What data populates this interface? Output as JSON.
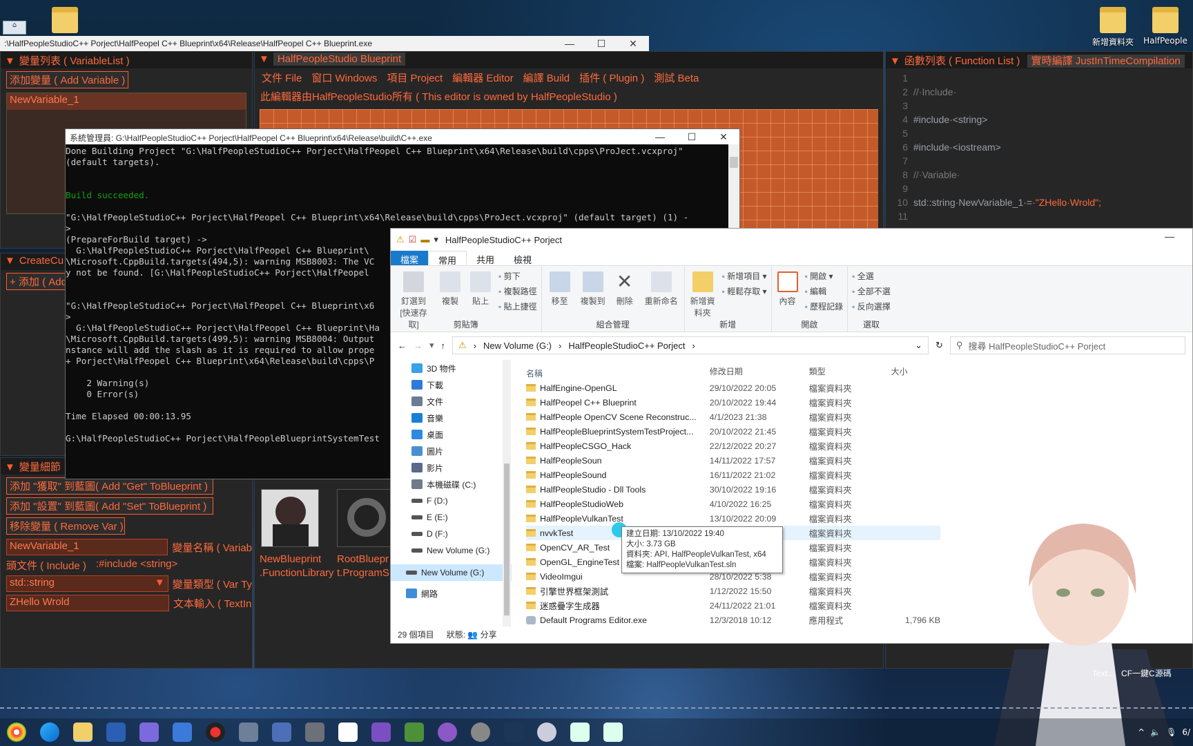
{
  "desktop": {
    "icons": [
      {
        "label": "新增資料夾"
      },
      {
        "label": "HalfPeople"
      }
    ]
  },
  "blueprint": {
    "window_title": ":\\HalfPeopleStudioC++ Porject\\HalfPeopel C++ Blueprint\\x64\\Release\\HalfPeopel C++ Blueprint.exe",
    "variable_panel": {
      "title": "變量列表 ( VariableList )",
      "add_button": "添加變量 ( Add Variable )",
      "items": [
        "NewVariable_1"
      ]
    },
    "create_panel": {
      "title": "CreateCu",
      "add_button": "+ 添加 ( Add"
    },
    "detail_panel": {
      "title": "變量細節",
      "add_get_button": "添加 \"獲取\" 到藍圖( Add \"Get\" ToBlueprint )",
      "add_set_button": "添加 \"設置\" 到藍圖( Add \"Set\" ToBlueprint )",
      "remove_button": "移除變量 ( Remove Var )",
      "name_value": "NewVariable_1",
      "name_label": "變量名稱 ( Variab",
      "include_label": "頭文件 ( Include )",
      "include_value": ":#include <string>",
      "type_value": "std::string",
      "type_label": "變量類型 ( Var Ty",
      "text_value": "ZHello Wrold",
      "text_label": "文本輸入 ( TextIn"
    },
    "editor": {
      "tab": "HalfPeopleStudio Blueprint",
      "menu": [
        "文件 File",
        "窗口 Windows",
        "項目 Project",
        "編輯器 Editor",
        "編譯 Build",
        "插件 ( Plugin )",
        "測試 Beta"
      ],
      "ownership": "此編輯器由HalfPeopleStudio所有 ( This editor is owned by HalfPeopleStudio )"
    },
    "assets": [
      {
        "label": "NewBlueprint .FunctionLibrary"
      },
      {
        "label": "RootBluepr t.ProgramS"
      }
    ],
    "function_panel": {
      "tab1": "函數列表 ( Function List )",
      "tab2": "實時編譯 JustInTimeCompilation"
    },
    "code": [
      {
        "n": "1",
        "t": ""
      },
      {
        "n": "2",
        "t": "//·Include·"
      },
      {
        "n": "3",
        "t": ""
      },
      {
        "n": "4",
        "t": "#include·<string>"
      },
      {
        "n": "5",
        "t": ""
      },
      {
        "n": "6",
        "t": "#include·<iostream>"
      },
      {
        "n": "7",
        "t": ""
      },
      {
        "n": "8",
        "t": "//·Variable·"
      },
      {
        "n": "9",
        "t": ""
      },
      {
        "n": "10",
        "t": "std::string·NewVariable_1·=·",
        "s": "\"ZHello·Wrold\";"
      },
      {
        "n": "11",
        "t": ""
      }
    ]
  },
  "console": {
    "title": "系統管理員: G:\\HalfPeopleStudioC++ Porject\\HalfPeopel C++ Blueprint\\x64\\Release\\build\\C++.exe",
    "lines": [
      "Done Building Project \"G:\\HalfPeopleStudioC++ Porject\\HalfPeopel C++ Blueprint\\x64\\Release\\build\\cpps\\ProJect.vcxproj\"",
      "(default targets).",
      "",
      "",
      "Build succeeded.",
      "",
      "\"G:\\HalfPeopleStudioC++ Porject\\HalfPeopel C++ Blueprint\\x64\\Release\\build\\cpps\\ProJect.vcxproj\" (default target) (1) -",
      ">",
      "(PrepareForBuild target) ->",
      "  G:\\HalfPeopleStudioC++ Porject\\HalfPeopel C++ Blueprint\\",
      "\\Microsoft.CppBuild.targets(494,5): warning MSB8003: The VC",
      "y not be found. [G:\\HalfPeopleStudioC++ Porject\\HalfPeopel",
      "",
      "",
      "\"G:\\HalfPeopleStudioC++ Porject\\HalfPeopel C++ Blueprint\\x6",
      ">",
      "  G:\\HalfPeopleStudioC++ Porject\\HalfPeopel C++ Blueprint\\Ha",
      "\\Microsoft.CppBuild.targets(499,5): warning MSB8004: Output",
      "nstance will add the slash as it is required to allow prope",
      "+ Porject\\HalfPeopel C++ Blueprint\\x64\\Release\\build\\cpps\\P",
      "",
      "    2 Warning(s)",
      "    0 Error(s)",
      "",
      "Time Elapsed 00:00:13.95",
      "",
      "G:\\HalfPeopleStudioC++ Porject\\HalfPeopleBlueprintSystemTest"
    ],
    "success_line_index": 4
  },
  "explorer": {
    "title": "HalfPeopleStudioC++ Porject",
    "tabs": [
      "檔案",
      "常用",
      "共用",
      "檢視"
    ],
    "ribbon": {
      "clipboard": {
        "name": "剪貼簿",
        "pin": "釘選到 [快速存取]",
        "copy": "複製",
        "paste": "貼上",
        "cut": "剪下",
        "copy_path": "複製路徑",
        "paste_shortcut": "貼上捷徑"
      },
      "organize": {
        "name": "組合管理",
        "move": "移至",
        "copy_to": "複製到",
        "delete": "刪除",
        "rename": "重新命名"
      },
      "new": {
        "name": "新增",
        "new_folder": "新增資料夾",
        "new_item": "新增項目 ▾",
        "easy_access": "輕鬆存取 ▾"
      },
      "open": {
        "name": "開啟",
        "properties": "內容",
        "open": "開啟 ▾",
        "edit": "編輯",
        "history": "歷程記錄"
      },
      "select": {
        "name": "選取",
        "all": "全選",
        "none": "全部不選",
        "invert": "反向選擇"
      }
    },
    "address": [
      "New Volume (G:)",
      "HalfPeopleStudioC++ Porject"
    ],
    "search_placeholder": "搜尋 HalfPeopleStudioC++ Porject",
    "nav": [
      "3D 物件",
      "下載",
      "文件",
      "音樂",
      "桌面",
      "圖片",
      "影片",
      "本機磁碟 (C:)",
      "F (D:)",
      "E (E:)",
      "D (F:)",
      "New Volume (G:)",
      "New Volume (G:)",
      "網路"
    ],
    "columns": {
      "name": "名稱",
      "date": "修改日期",
      "type": "類型",
      "size": "大小"
    },
    "files": [
      {
        "name": "HalfEngine-OpenGL",
        "date": "29/10/2022 20:05",
        "type": "檔案資料夾",
        "size": ""
      },
      {
        "name": "HalfPeopel C++ Blueprint",
        "date": "20/10/2022 19:44",
        "type": "檔案資料夾",
        "size": ""
      },
      {
        "name": "HalfPeople OpenCV Scene Reconstruc...",
        "date": "4/1/2023 21:38",
        "type": "檔案資料夾",
        "size": ""
      },
      {
        "name": "HalfPeopleBlueprintSystemTestProject...",
        "date": "20/10/2022 21:45",
        "type": "檔案資料夾",
        "size": ""
      },
      {
        "name": "HalfPeopleCSGO_Hack",
        "date": "22/12/2022 20:27",
        "type": "檔案資料夾",
        "size": ""
      },
      {
        "name": "HalfPeopleSoun",
        "date": "14/11/2022 17:57",
        "type": "檔案資料夾",
        "size": ""
      },
      {
        "name": "HalfPeopleSound",
        "date": "16/11/2022 21:02",
        "type": "檔案資料夾",
        "size": ""
      },
      {
        "name": "HalfPeopleStudio - Dll Tools",
        "date": "30/10/2022 19:16",
        "type": "檔案資料夾",
        "size": ""
      },
      {
        "name": "HalfPeopleStudioWeb",
        "date": "4/10/2022 16:25",
        "type": "檔案資料夾",
        "size": ""
      },
      {
        "name": "HalfPeopleVulkanTest",
        "date": "13/10/2022 20:09",
        "type": "檔案資料夾",
        "size": ""
      },
      {
        "name": "nvvkTest",
        "date": "",
        "type": "檔案資料夾",
        "size": ""
      },
      {
        "name": "OpenCV_AR_Test",
        "date": "",
        "type": "檔案資料夾",
        "size": ""
      },
      {
        "name": "OpenGL_EngineTest",
        "date": "",
        "type": "檔案資料夾",
        "size": ""
      },
      {
        "name": "VideoImgui",
        "date": "28/10/2022 5:38",
        "type": "檔案資料夾",
        "size": ""
      },
      {
        "name": "引擎世界框架測試",
        "date": "1/12/2022 15:50",
        "type": "檔案資料夾",
        "size": ""
      },
      {
        "name": "迷惑疊字生成器",
        "date": "24/11/2022 21:01",
        "type": "檔案資料夾",
        "size": ""
      },
      {
        "name": "Default Programs Editor.exe",
        "date": "12/3/2018 10:12",
        "type": "應用程式",
        "size": "1,796 KB"
      }
    ],
    "hover_index": 10,
    "tooltip": [
      "建立日期: 13/10/2022 19:40",
      "大小: 3.73 GB",
      "資料夾: API, HalfPeopleVulkanTest, x64",
      "檔案: HalfPeopleVulkanTest.sln"
    ],
    "status": {
      "count": "29 個項目",
      "state": "狀態: 👥 分享"
    }
  },
  "tray": {
    "label1": "Text...",
    "label2": "CF一鍵C源碼",
    "clock": "6/"
  }
}
